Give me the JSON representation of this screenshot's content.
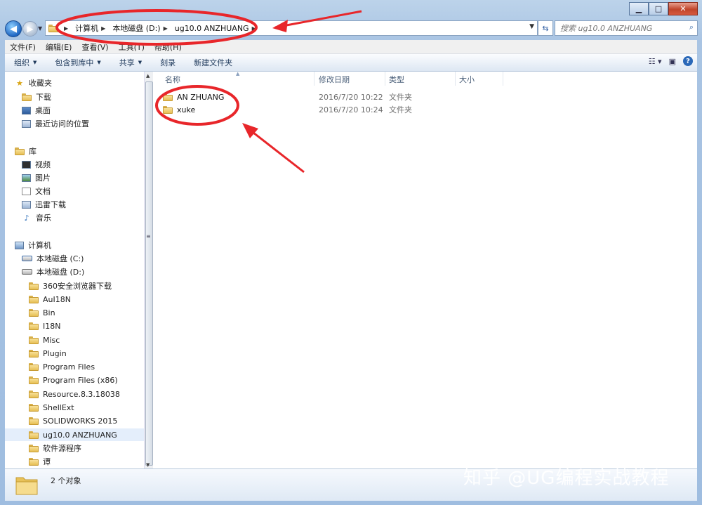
{
  "window": {
    "minimize_glyph": "▁",
    "maximize_glyph": "□",
    "close_glyph": "✕"
  },
  "nav": {
    "back_glyph": "◀",
    "forward_glyph": "▶",
    "breadcrumbs": [
      "计算机",
      "本地磁盘 (D:)",
      "ug10.0 ANZHUANG"
    ],
    "search_placeholder": "搜索 ug10.0 ANZHUANG"
  },
  "menu": [
    "文件(F)",
    "编辑(E)",
    "查看(V)",
    "工具(T)",
    "帮助(H)"
  ],
  "toolbar": [
    "组织",
    "包含到库中",
    "共享",
    "刻录",
    "新建文件夹"
  ],
  "sidebar": {
    "favorites": {
      "label": "收藏夹",
      "items": [
        "下载",
        "桌面",
        "最近访问的位置"
      ]
    },
    "libraries": {
      "label": "库",
      "items": [
        "视频",
        "图片",
        "文档",
        "迅雷下载",
        "音乐"
      ]
    },
    "computer": {
      "label": "计算机",
      "drives": [
        "本地磁盘 (C:)",
        "本地磁盘 (D:)"
      ],
      "folders": [
        "360安全浏览器下载",
        "AuI18N",
        "Bin",
        "I18N",
        "Misc",
        "Plugin",
        "Program Files",
        "Program Files (x86)",
        "Resource.8.3.18038",
        "ShellExt",
        "SOLIDWORKS 2015",
        "ug10.0 ANZHUANG",
        "软件源程序",
        "谭"
      ],
      "selected": "ug10.0 ANZHUANG"
    }
  },
  "columns": [
    "名称",
    "修改日期",
    "类型",
    "大小"
  ],
  "files": [
    {
      "name": "AN ZHUANG",
      "date": "2016/7/20 10:22",
      "type": "文件夹"
    },
    {
      "name": "xuke",
      "date": "2016/7/20 10:24",
      "type": "文件夹"
    }
  ],
  "status": {
    "count": "2 个对象"
  },
  "watermark": "知乎 @UG编程实战教程",
  "colors": {
    "annotation": "#e8262a",
    "selection": "#e4eefb",
    "accent": "#2a68b8"
  }
}
